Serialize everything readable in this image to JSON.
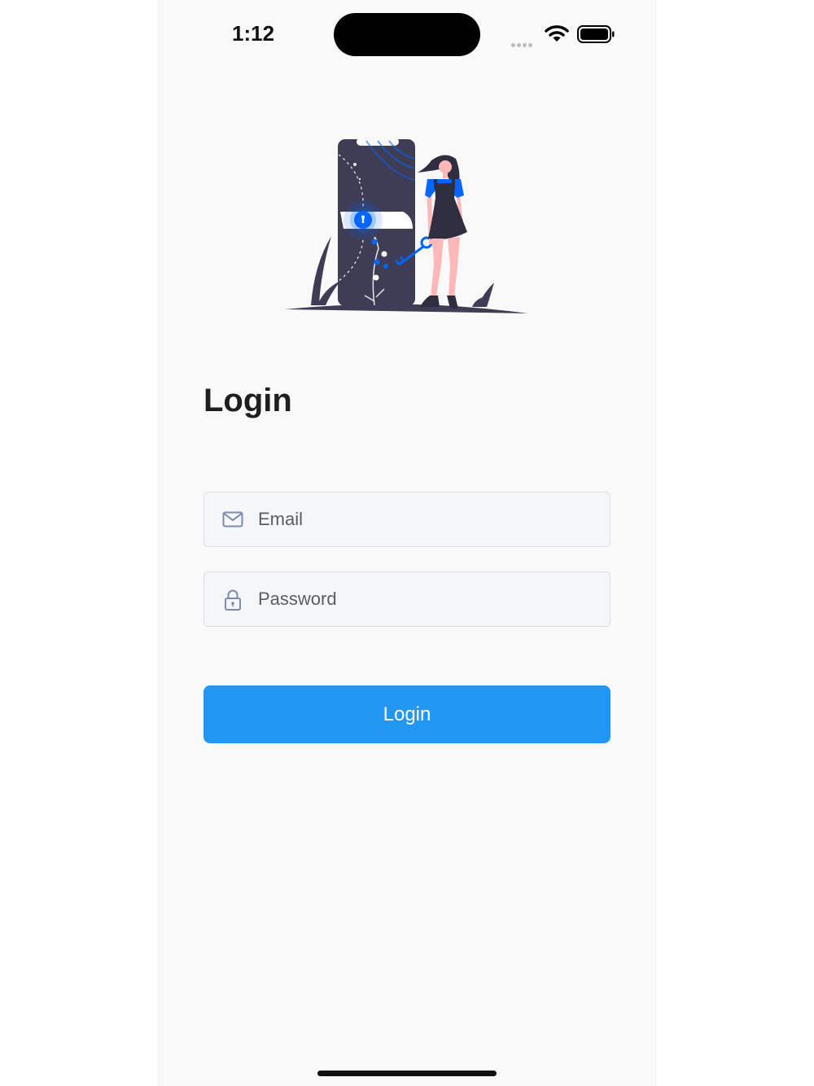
{
  "status_bar": {
    "time": "1:12"
  },
  "login": {
    "title": "Login",
    "email_placeholder": "Email",
    "password_placeholder": "Password",
    "button_label": "Login"
  },
  "icons": {
    "email": "mail-icon",
    "password": "lock-icon",
    "status": [
      "wifi-icon",
      "battery-icon"
    ]
  },
  "colors": {
    "accent": "#2196f3",
    "background": "#f9f9f9",
    "illustration_dark": "#3f3d56",
    "illustration_accent": "#0066ff"
  }
}
